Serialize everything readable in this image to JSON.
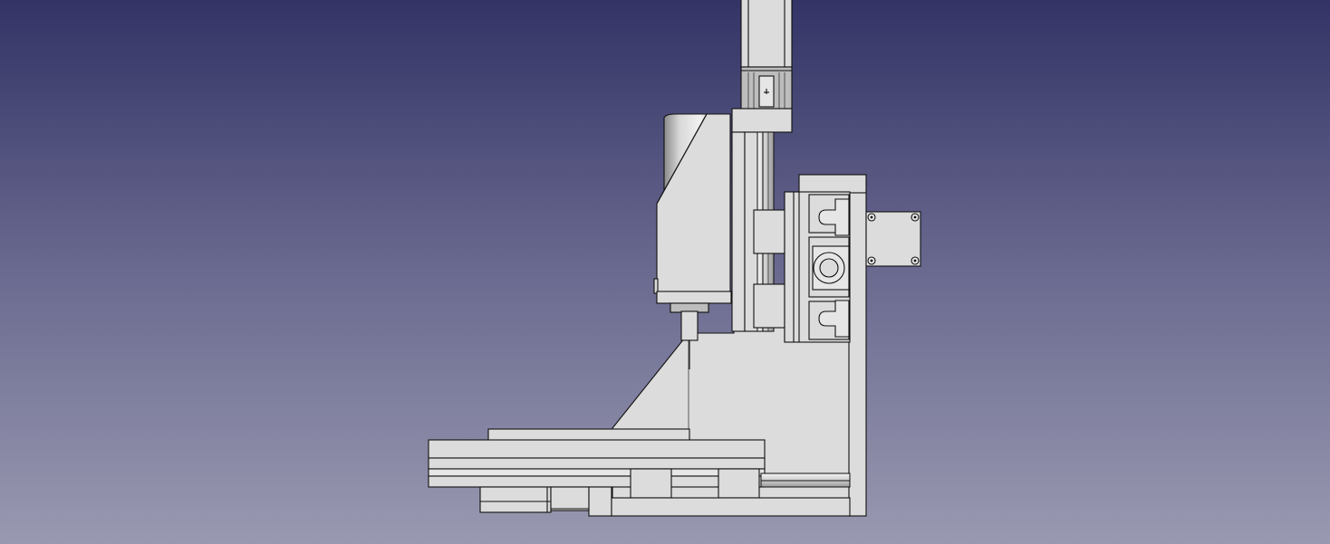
{
  "scene": {
    "view": "3d-viewport",
    "background_top": "#333366",
    "background_bottom": "#9999b1",
    "part_color": "#dcdcdc",
    "edge_color": "#111111",
    "model": "cnc-mill-side-view"
  }
}
